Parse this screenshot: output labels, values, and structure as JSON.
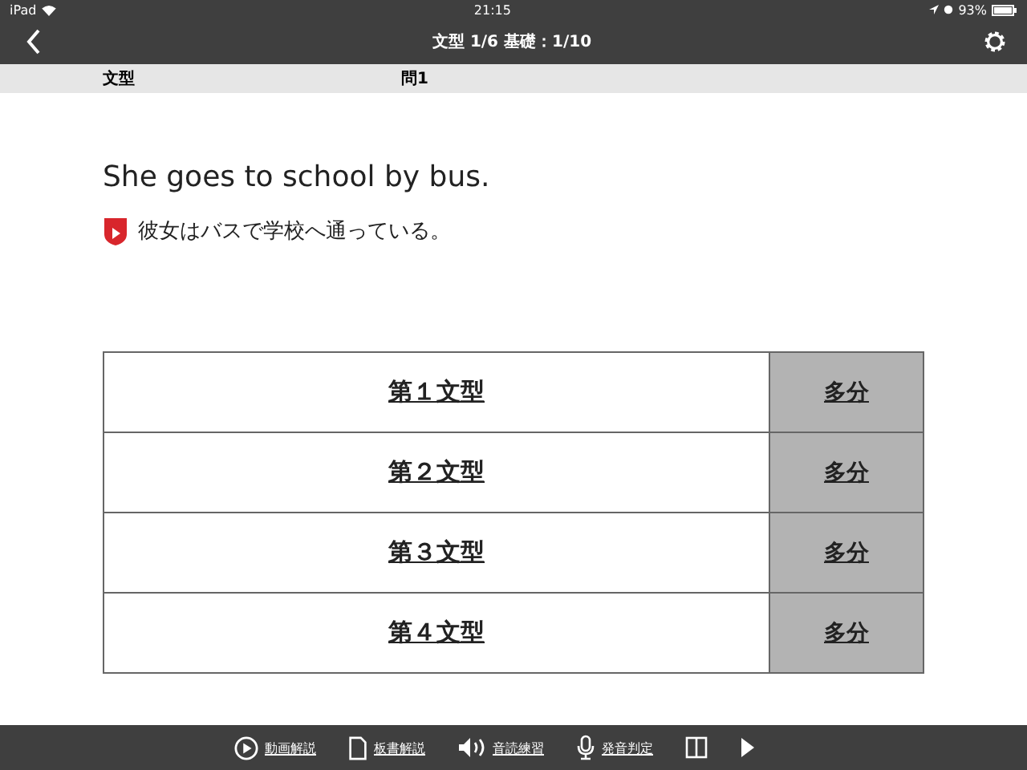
{
  "status_bar": {
    "device": "iPad",
    "time": "21:15",
    "battery": "93%"
  },
  "nav": {
    "title": "文型 1/6 基礎：1/10"
  },
  "header": {
    "category": "文型",
    "question": "問1"
  },
  "sentence": "She goes to school by bus.",
  "translation": "彼女はバスで学校へ通っている。",
  "choices": [
    {
      "label": "第１文型",
      "hint": "多分"
    },
    {
      "label": "第２文型",
      "hint": "多分"
    },
    {
      "label": "第３文型",
      "hint": "多分"
    },
    {
      "label": "第４文型",
      "hint": "多分"
    }
  ],
  "toolbar": [
    {
      "kind": "video",
      "label": "動画解説"
    },
    {
      "kind": "document",
      "label": "板書解説"
    },
    {
      "kind": "speaker",
      "label": "音読練習"
    },
    {
      "kind": "mic",
      "label": "発音判定"
    },
    {
      "kind": "book"
    },
    {
      "kind": "play"
    }
  ]
}
